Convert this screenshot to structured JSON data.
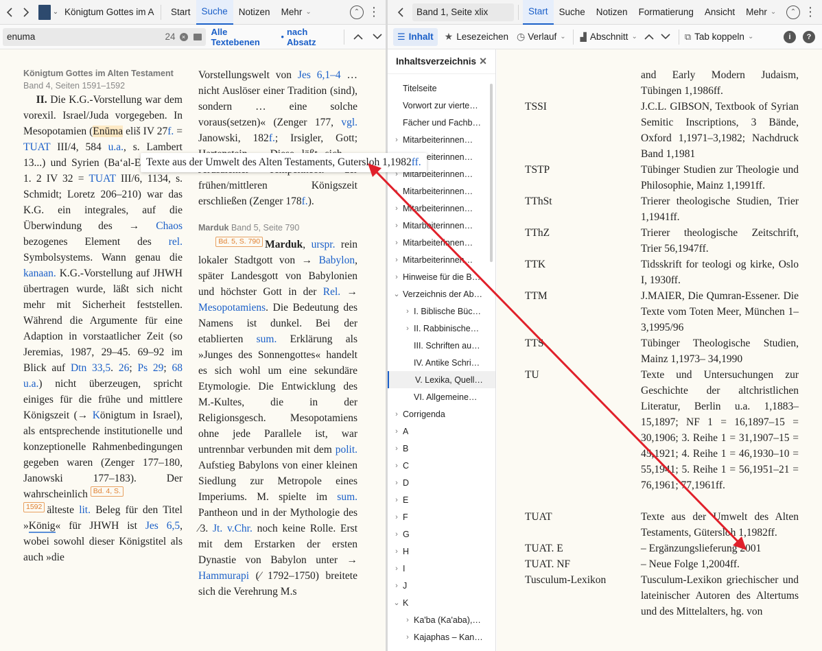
{
  "left_toolbar": {
    "doc_title": "Königtum Gottes im A",
    "tabs": [
      "Start",
      "Suche",
      "Notizen",
      "Mehr"
    ],
    "active_tab": "Suche"
  },
  "search_bar": {
    "query": "enuma",
    "count": "24",
    "scope_all": "Alle Textebenen",
    "scope_sep": "•",
    "scope_para": "nach Absatz"
  },
  "right_toolbar": {
    "location": "Band 1, Seite xlix",
    "tabs": [
      "Start",
      "Suche",
      "Notizen",
      "Formatierung",
      "Ansicht",
      "Mehr"
    ],
    "active_tab": "Start"
  },
  "sub_toolbar": {
    "inhalt": "Inhalt",
    "lesezeichen": "Lesezeichen",
    "verlauf": "Verlauf",
    "abschnitt": "Abschnitt",
    "tab_koppeln": "Tab koppeln"
  },
  "toc": {
    "title": "Inhaltsverzeichnis",
    "items": [
      {
        "label": "Titelseite",
        "chev": "",
        "indent": 0
      },
      {
        "label": "Vorwort zur vierte…",
        "chev": "",
        "indent": 0
      },
      {
        "label": "Fächer und Fachb…",
        "chev": "",
        "indent": 0
      },
      {
        "label": "Mitarbeiterinnen…",
        "chev": "›",
        "indent": 0
      },
      {
        "label": "Mitarbeiterinnen…",
        "chev": "›",
        "indent": 0
      },
      {
        "label": "Mitarbeiterinnen…",
        "chev": "›",
        "indent": 0
      },
      {
        "label": "Mitarbeiterinnen…",
        "chev": "›",
        "indent": 0
      },
      {
        "label": "Mitarbeiterinnen…",
        "chev": "›",
        "indent": 0
      },
      {
        "label": "Mitarbeiterinnen…",
        "chev": "›",
        "indent": 0
      },
      {
        "label": "Mitarbeiterinnen…",
        "chev": "›",
        "indent": 0
      },
      {
        "label": "Mitarbeiterinnen…",
        "chev": "›",
        "indent": 0
      },
      {
        "label": "Hinweise für die B…",
        "chev": "›",
        "indent": 0
      },
      {
        "label": "Verzeichnis der Ab…",
        "chev": "⌄",
        "indent": 0
      },
      {
        "label": "I. Biblische Büc…",
        "chev": "›",
        "indent": 1
      },
      {
        "label": "II. Rabbinische…",
        "chev": "›",
        "indent": 1
      },
      {
        "label": "III. Schriften au…",
        "chev": "",
        "indent": 1
      },
      {
        "label": "IV. Antike Schri…",
        "chev": "",
        "indent": 1
      },
      {
        "label": "V. Lexika, Quell…",
        "chev": "",
        "indent": 1,
        "selected": true
      },
      {
        "label": "VI. Allgemeine…",
        "chev": "",
        "indent": 1
      },
      {
        "label": "Corrigenda",
        "chev": "›",
        "indent": 0
      },
      {
        "label": "A",
        "chev": "›",
        "indent": 0
      },
      {
        "label": "B",
        "chev": "›",
        "indent": 0
      },
      {
        "label": "C",
        "chev": "›",
        "indent": 0
      },
      {
        "label": "D",
        "chev": "›",
        "indent": 0
      },
      {
        "label": "E",
        "chev": "›",
        "indent": 0
      },
      {
        "label": "F",
        "chev": "›",
        "indent": 0
      },
      {
        "label": "G",
        "chev": "›",
        "indent": 0
      },
      {
        "label": "H",
        "chev": "›",
        "indent": 0
      },
      {
        "label": "I",
        "chev": "›",
        "indent": 0
      },
      {
        "label": "J",
        "chev": "›",
        "indent": 0
      },
      {
        "label": "K",
        "chev": "⌄",
        "indent": 0
      },
      {
        "label": "Ka'ba (Ka'aba),…",
        "chev": "›",
        "indent": 1
      },
      {
        "label": "Kajaphas – Kan…",
        "chev": "›",
        "indent": 1
      }
    ]
  },
  "tooltip": {
    "text": "Texte aus der Umwelt des Alten Testaments, Gutersloh 1,1982",
    "link": "ff."
  },
  "left_doc": {
    "col1_header_title": "Königtum Gottes im Alten Testament",
    "col1_header_sub": "Band 4, Seiten 1591–1592",
    "col2_marduk_header": "Marduk",
    "col2_marduk_sub": "Band 5, Seite 790"
  },
  "abbrev_entries": [
    {
      "key": "",
      "value": "and Early Modern Judaism, Tübingen 1,1986ff."
    },
    {
      "key": "TSSI",
      "value": "J.C.L. GIBSON, Textbook of Syrian Semitic Inscriptions, 3 Bände, Oxford 1,1971–3,1982; Nachdruck Band 1,1981"
    },
    {
      "key": "TSTP",
      "value": "Tübinger Studien zur Theologie und Philosophie, Mainz 1,1991ff."
    },
    {
      "key": "TThSt",
      "value": "Trierer theologische Studien, Trier 1,1941ff."
    },
    {
      "key": "TThZ",
      "value": "Trierer theologische Zeitschrift, Trier 56,1947ff."
    },
    {
      "key": "TTK",
      "value": "Tidsskrift for teologi og kirke, Oslo I, 1930ff."
    },
    {
      "key": "TTM",
      "value": "J.MAIER, Die Qumran-Essener. Die Texte vom Toten Meer, München 1–3,1995/96"
    },
    {
      "key": "TTS",
      "value": "Tübinger Theologische Studien, Mainz 1,1973– 34,1990"
    },
    {
      "key": "TU",
      "value": "Texte und Untersuchungen zur Geschichte der altchristlichen Literatur, Berlin u.a. 1,1883–15,1897; NF 1 = 16,1897–15 = 30,1906; 3. Reihe 1 = 31,1907–15 = 45,1921; 4. Reihe 1 = 46,1930–10 = 55,1941; 5. Reihe 1 = 56,1951–21 = 76,1961; 77,1961ff."
    },
    {
      "key": "TUAT",
      "value": "Texte aus der Umwelt des Alten Testaments, Gütersloh 1,1982ff."
    },
    {
      "key": "TUAT. E",
      "value": "– Ergänzungslieferung 2001"
    },
    {
      "key": "TUAT. NF",
      "value": "– Neue Folge 1,2004ff."
    },
    {
      "key": "Tusculum-Lexikon",
      "value": "Tusculum-Lexikon griechischer und lateinischer Autoren des Altertums und des Mittelalters, hg. von"
    }
  ],
  "colors": {
    "link": "#1a5fc8",
    "arrow": "#e0202a",
    "marker": "#e08030",
    "page_bg": "#fcfaf3"
  }
}
